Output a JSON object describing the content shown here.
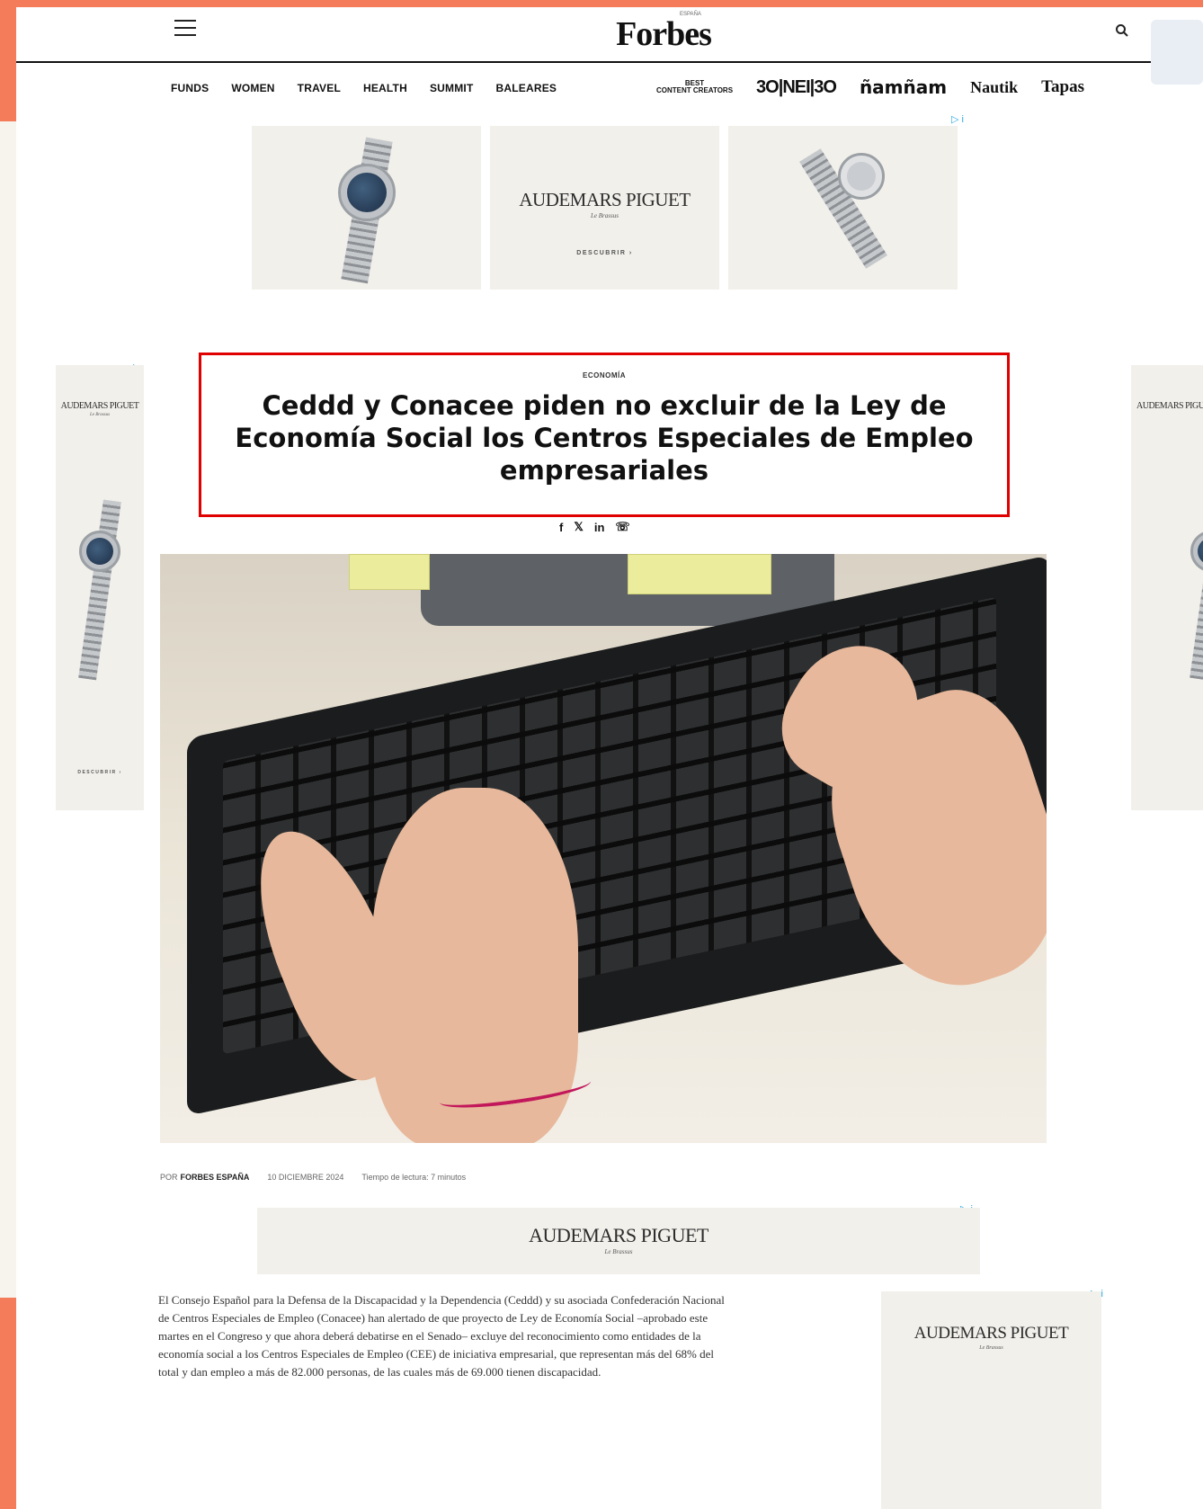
{
  "header": {
    "logo": "Forbes",
    "logo_edition": "ESPAÑA"
  },
  "nav": {
    "items": [
      "FUNDS",
      "WOMEN",
      "TRAVEL",
      "HEALTH",
      "SUMMIT",
      "BALEARES"
    ],
    "brands": {
      "best_content_creators_top": "BEST",
      "best_content_creators_bottom": "CONTENT CREATORS",
      "under30": "3O|NEI|3O",
      "amam": "ñamñam",
      "nautik": "Nautik",
      "tapas": "Tapas"
    }
  },
  "ads": {
    "adchoices": "▷ i",
    "brand": "AUDEMARS PIGUET",
    "brand_sub": "Le Brassus",
    "cta": "DESCUBRIR  ›"
  },
  "article": {
    "category": "ECONOMÍA",
    "headline": "Ceddd y Conacee piden no excluir de la Ley de Economía Social los Centros Especiales de Empleo empresariales",
    "share": [
      "f",
      "𝕏",
      "in",
      "☏"
    ],
    "byline": {
      "prefix": "POR",
      "author": "FORBES ESPAÑA",
      "date": "10 DICIEMBRE 2024",
      "reading_time": "Tiempo de lectura: 7 minutos"
    },
    "body": "El Consejo Español para la Defensa de la Discapacidad y la Dependencia (Ceddd) y su asociada Confederación Nacional de Centros Especiales de Empleo (Conacee) han alertado de que proyecto de Ley de Economía Social –aprobado este martes en el Congreso y que ahora deberá debatirse en el Senado– excluye del reconocimiento como entidades de la economía social a los Centros Especiales de Empleo (CEE) de iniciativa empresarial, que representan más del 68% del total y dan empleo a más de 82.000 personas, de las cuales más de 69.000 tienen discapacidad."
  },
  "colors": {
    "frame": "#f57c5a",
    "highlight": "#e00000",
    "adchoices": "#29a9e0"
  }
}
